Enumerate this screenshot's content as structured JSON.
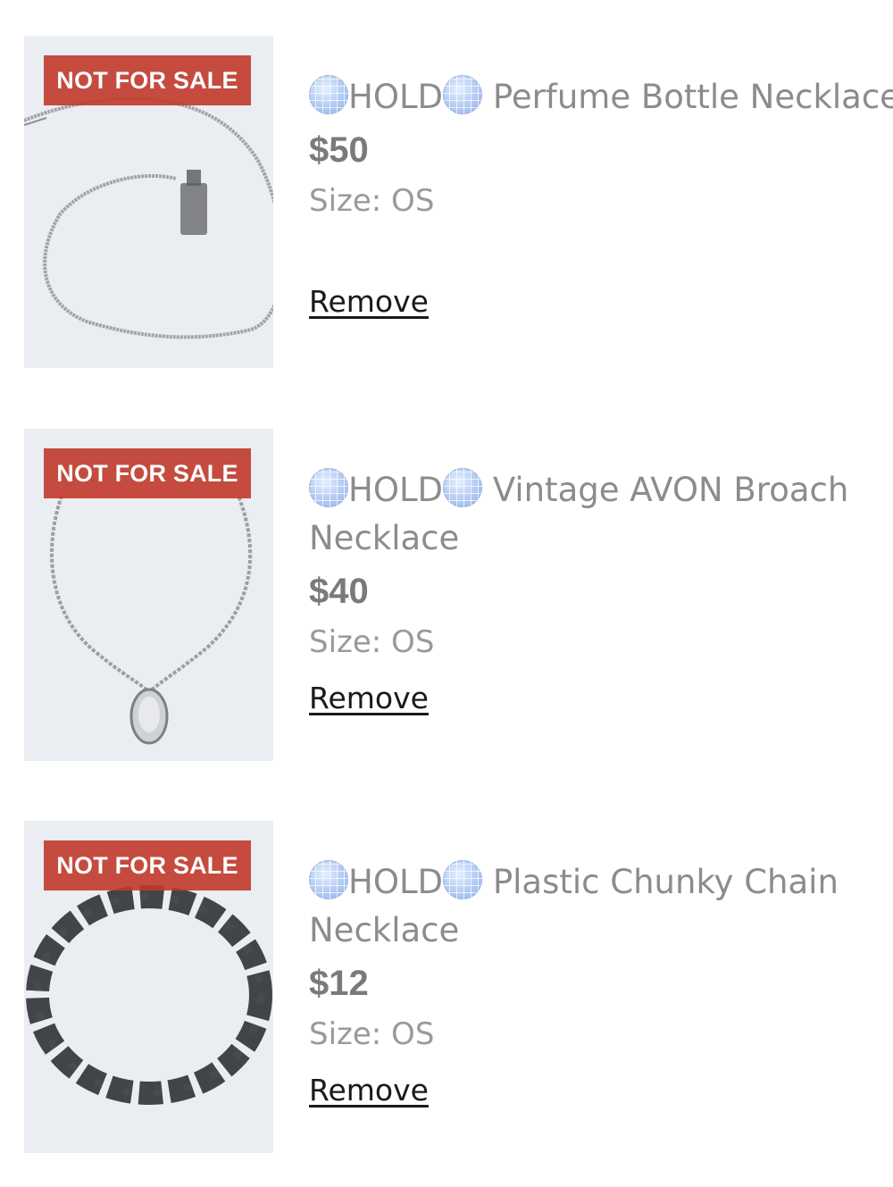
{
  "items": [
    {
      "badge": "NOT FOR SALE",
      "hold_label": "HOLD",
      "name": "Perfume Bottle Necklace",
      "price": "$50",
      "size": "Size: OS",
      "remove": "Remove"
    },
    {
      "badge": "NOT FOR SALE",
      "hold_label": "HOLD",
      "name": "Vintage AVON Broach Necklace",
      "price": "$40",
      "size": "Size: OS",
      "remove": "Remove"
    },
    {
      "badge": "NOT FOR SALE",
      "hold_label": "HOLD",
      "name": "Plastic Chunky Chain Necklace",
      "price": "$12",
      "size": "Size: OS",
      "remove": "Remove"
    }
  ],
  "colors": {
    "badge": "#c03a2b",
    "title": "#8c8c8c",
    "price": "#7a7a7a",
    "photo_bg": "#eaedf2"
  },
  "icons": [
    "globe-icon"
  ]
}
